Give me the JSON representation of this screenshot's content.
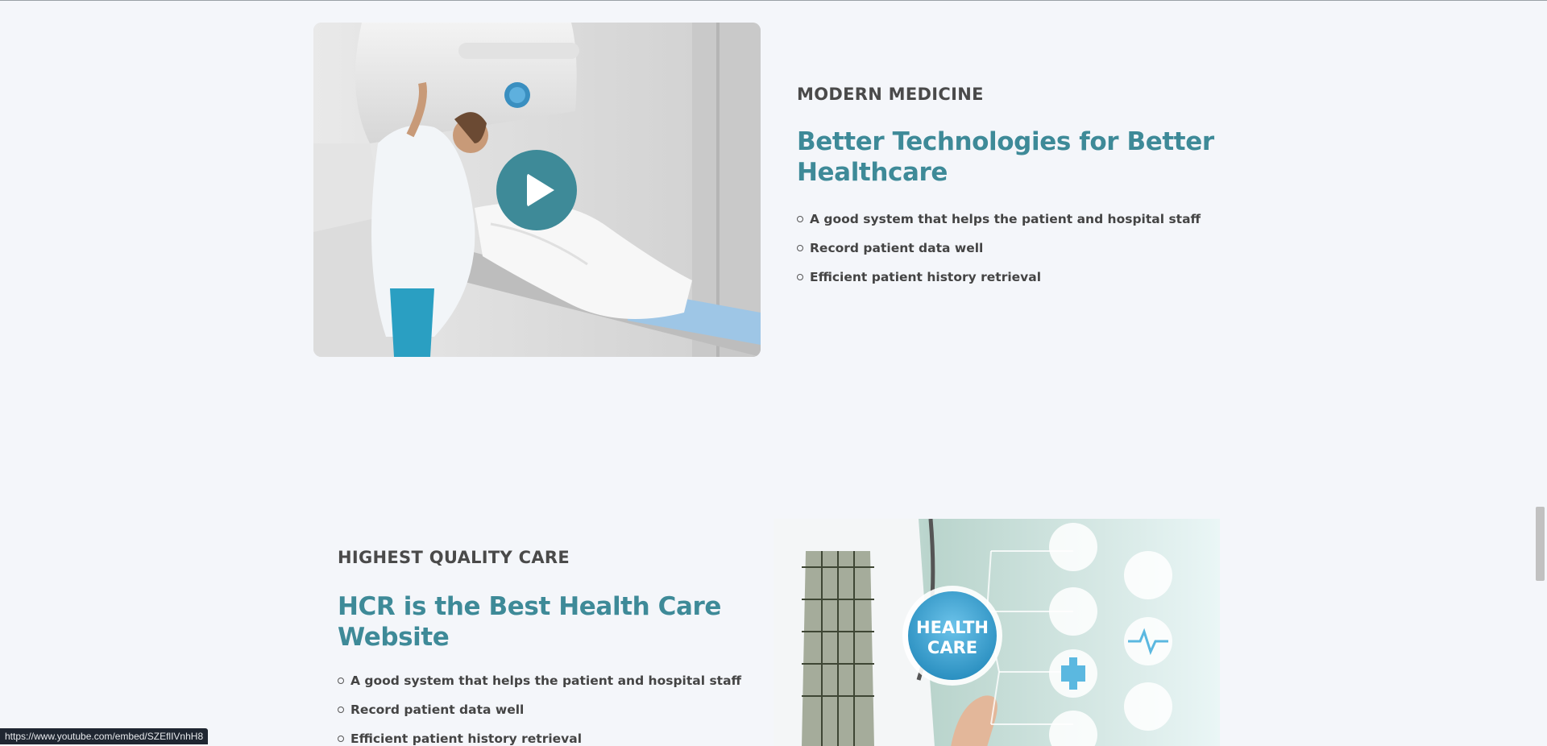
{
  "section_technology": {
    "eyebrow": "MODERN MEDICINE",
    "heading": "Better Technologies for Better Healthcare",
    "features": [
      "A good system that helps the patient and hospital staff",
      "Record patient data well",
      "Efficient patient history retrieval"
    ],
    "play_icon": "play-icon"
  },
  "section_quality": {
    "eyebrow": "HIGHEST QUALITY CARE",
    "heading": "HCR is the Best Health Care Website",
    "features": [
      "A good system that helps the patient and hospital staff",
      "Record patient data well",
      "Efficient patient history retrieval"
    ],
    "image_badge_line1": "HEALTH",
    "image_badge_line2": "CARE"
  },
  "status_bar": {
    "url": "https://www.youtube.com/embed/SZEflIVnhH8"
  },
  "colors": {
    "accent": "#3e8a98",
    "text": "#4a4a4a",
    "background": "#f4f6fa"
  }
}
